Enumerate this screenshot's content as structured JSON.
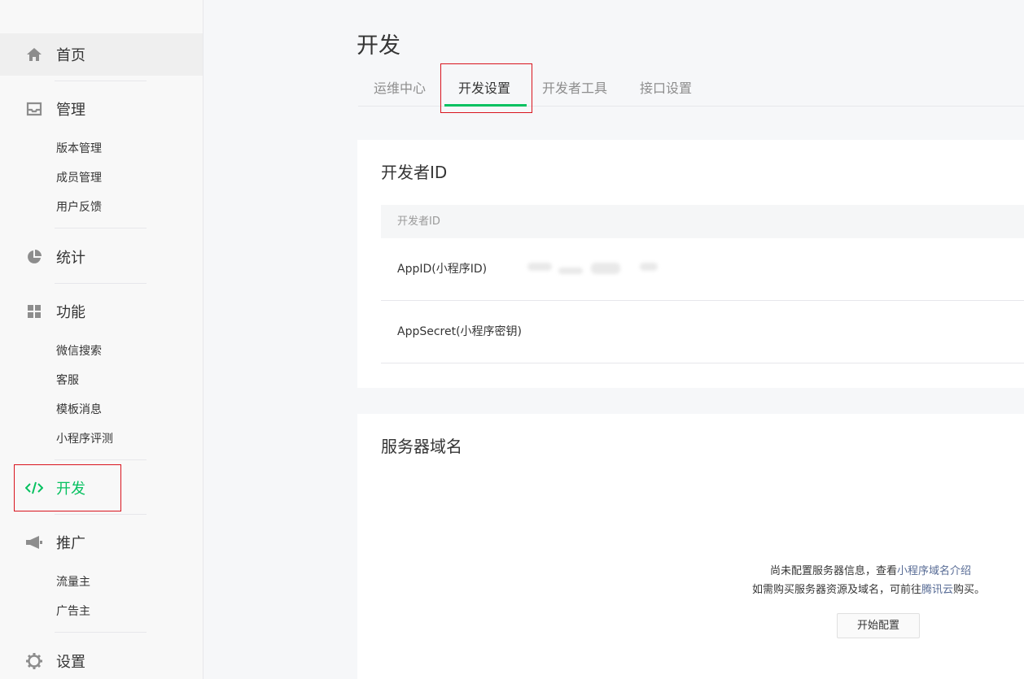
{
  "sidebar": {
    "home": {
      "label": "首页",
      "icon": "home-icon"
    },
    "manage": {
      "label": "管理",
      "icon": "inbox-icon",
      "items": [
        "版本管理",
        "成员管理",
        "用户反馈"
      ]
    },
    "stats": {
      "label": "统计",
      "icon": "pie-chart-icon"
    },
    "features": {
      "label": "功能",
      "icon": "grid-icon",
      "items": [
        "微信搜索",
        "客服",
        "模板消息",
        "小程序评测"
      ]
    },
    "develop": {
      "label": "开发",
      "icon": "code-icon",
      "active": true
    },
    "promote": {
      "label": "推广",
      "icon": "megaphone-icon",
      "items": [
        "流量主",
        "广告主"
      ]
    },
    "settings": {
      "label": "设置",
      "icon": "gear-icon"
    }
  },
  "page": {
    "title": "开发",
    "tabs": [
      "运维中心",
      "开发设置",
      "开发者工具",
      "接口设置"
    ],
    "active_tab": "开发设置"
  },
  "developer_id": {
    "title": "开发者ID",
    "table_header": "开发者ID",
    "rows": [
      {
        "label": "AppID(小程序ID)"
      },
      {
        "label": "AppSecret(小程序密钥)"
      }
    ]
  },
  "server_domain": {
    "title": "服务器域名",
    "line1_prefix": "尚未配置服务器信息，查看",
    "line1_link": "小程序域名介绍",
    "line2_prefix": "如需购买服务器资源及域名，可前往",
    "line2_link": "腾讯云",
    "line2_suffix": "购买。",
    "button": "开始配置"
  },
  "colors": {
    "accent": "#07c160",
    "link": "#576b95",
    "highlight_border": "#d9141e"
  }
}
